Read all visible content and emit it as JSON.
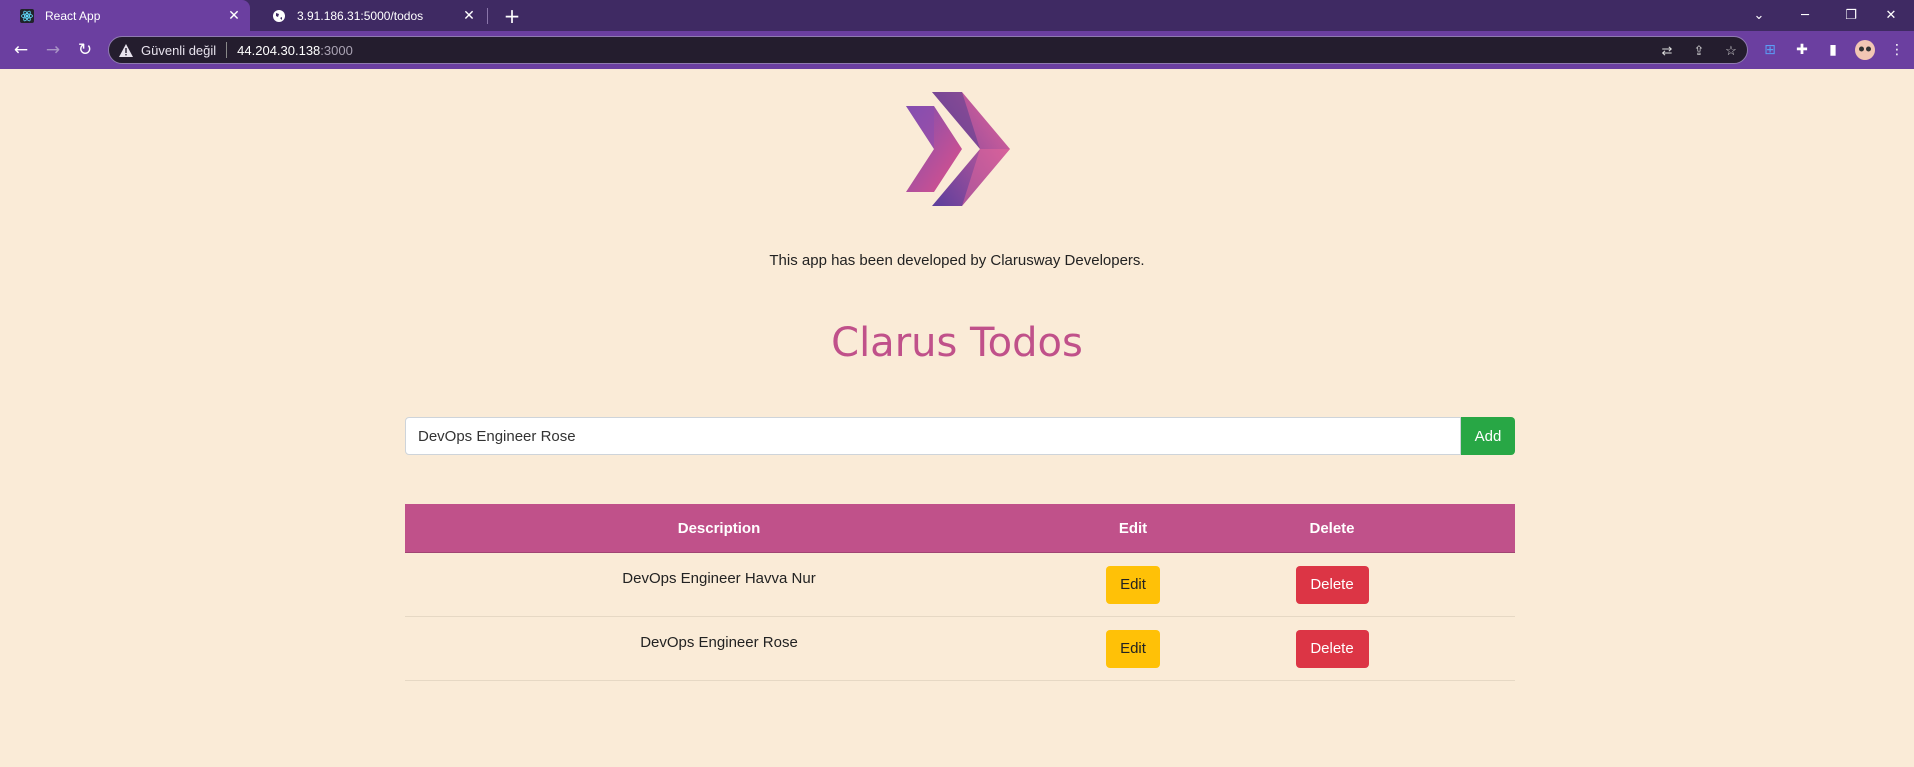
{
  "browser": {
    "tabs": [
      {
        "title": "React App",
        "favicon": "react-icon",
        "active": true
      },
      {
        "title": "3.91.186.31:5000/todos",
        "favicon": "globe-icon",
        "active": false
      }
    ],
    "address": {
      "security_label": "Güvenli değil",
      "host": "44.204.30.138",
      "port": ":3000"
    }
  },
  "page": {
    "tagline": "This app has been developed by Clarusway Developers.",
    "title": "Clarus Todos",
    "input_value": "DevOps Engineer Rose",
    "add_label": "Add",
    "columns": {
      "description": "Description",
      "edit": "Edit",
      "delete": "Delete"
    },
    "todos": [
      {
        "description": "DevOps Engineer Havva Nur",
        "edit_label": "Edit",
        "delete_label": "Delete"
      },
      {
        "description": "DevOps Engineer Rose",
        "edit_label": "Edit",
        "delete_label": "Delete"
      }
    ]
  },
  "colors": {
    "background": "#faebd7",
    "accent": "#c0518a",
    "add": "#28a745",
    "edit": "#ffc107",
    "delete": "#dc3545"
  }
}
